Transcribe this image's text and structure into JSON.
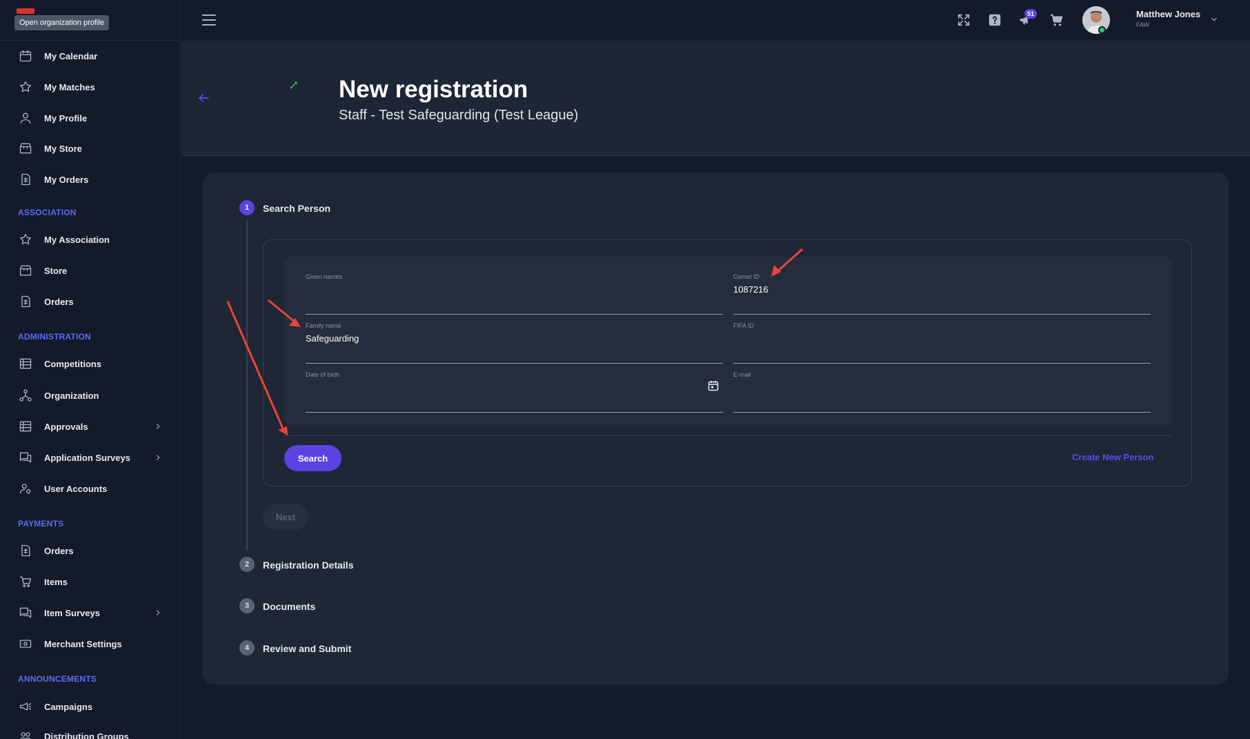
{
  "tooltip": "Open organization profile",
  "sidebar": {
    "items": [
      {
        "label": "My Calendar",
        "icon": "calendar-icon"
      },
      {
        "label": "My Matches",
        "icon": "star-icon"
      },
      {
        "label": "My Profile",
        "icon": "person-icon"
      },
      {
        "label": "My Store",
        "icon": "store-icon"
      },
      {
        "label": "My Orders",
        "icon": "receipt-icon"
      }
    ],
    "association_title": "ASSOCIATION",
    "association_items": [
      {
        "label": "My Association",
        "icon": "star-icon"
      },
      {
        "label": "Store",
        "icon": "store-icon"
      },
      {
        "label": "Orders",
        "icon": "receipt-icon"
      }
    ],
    "administration_title": "ADMINISTRATION",
    "administration_items": [
      {
        "label": "Competitions",
        "icon": "list-icon"
      },
      {
        "label": "Organization",
        "icon": "hierarchy-icon"
      },
      {
        "label": "Approvals",
        "icon": "list-icon"
      },
      {
        "label": "Application Surveys",
        "icon": "chat-icon"
      },
      {
        "label": "User Accounts",
        "icon": "user-settings-icon"
      }
    ],
    "payments_title": "PAYMENTS",
    "payments_items": [
      {
        "label": "Orders",
        "icon": "receipt-icon"
      },
      {
        "label": "Items",
        "icon": "cart-icon"
      },
      {
        "label": "Item Surveys",
        "icon": "chat-icon"
      },
      {
        "label": "Merchant Settings",
        "icon": "money-icon"
      }
    ],
    "announcements_title": "ANNOUNCEMENTS",
    "announcements_items": [
      {
        "label": "Campaigns",
        "icon": "megaphone-icon"
      },
      {
        "label": "Distribution Groups",
        "icon": "group-icon"
      }
    ]
  },
  "header": {
    "notification_count": "51",
    "user_name": "Matthew Jones",
    "user_org": "FAW"
  },
  "page": {
    "title": "New registration",
    "subtitle": "Staff - Test Safeguarding (Test League)"
  },
  "steps": [
    {
      "number": "1",
      "label": "Search Person",
      "state": "active"
    },
    {
      "number": "2",
      "label": "Registration Details",
      "state": "inactive"
    },
    {
      "number": "3",
      "label": "Documents",
      "state": "inactive"
    },
    {
      "number": "4",
      "label": "Review and Submit",
      "state": "inactive"
    }
  ],
  "form": {
    "given_names": {
      "label": "Given names",
      "value": ""
    },
    "comet_id": {
      "label": "Comet ID",
      "value": "1087216"
    },
    "family_name": {
      "label": "Family name",
      "value": "Safeguarding"
    },
    "fifa_id": {
      "label": "FIFA ID",
      "value": ""
    },
    "date_of_birth": {
      "label": "Date of birth",
      "value": ""
    },
    "email": {
      "label": "E-mail",
      "value": ""
    }
  },
  "buttons": {
    "search": "Search",
    "create_new_person": "Create New Person",
    "next": "Next"
  },
  "colors": {
    "accent": "#5a43e0",
    "link": "#5b4cf0",
    "section_title": "#5b6cf3",
    "annotation_arrow": "#e8453a"
  }
}
